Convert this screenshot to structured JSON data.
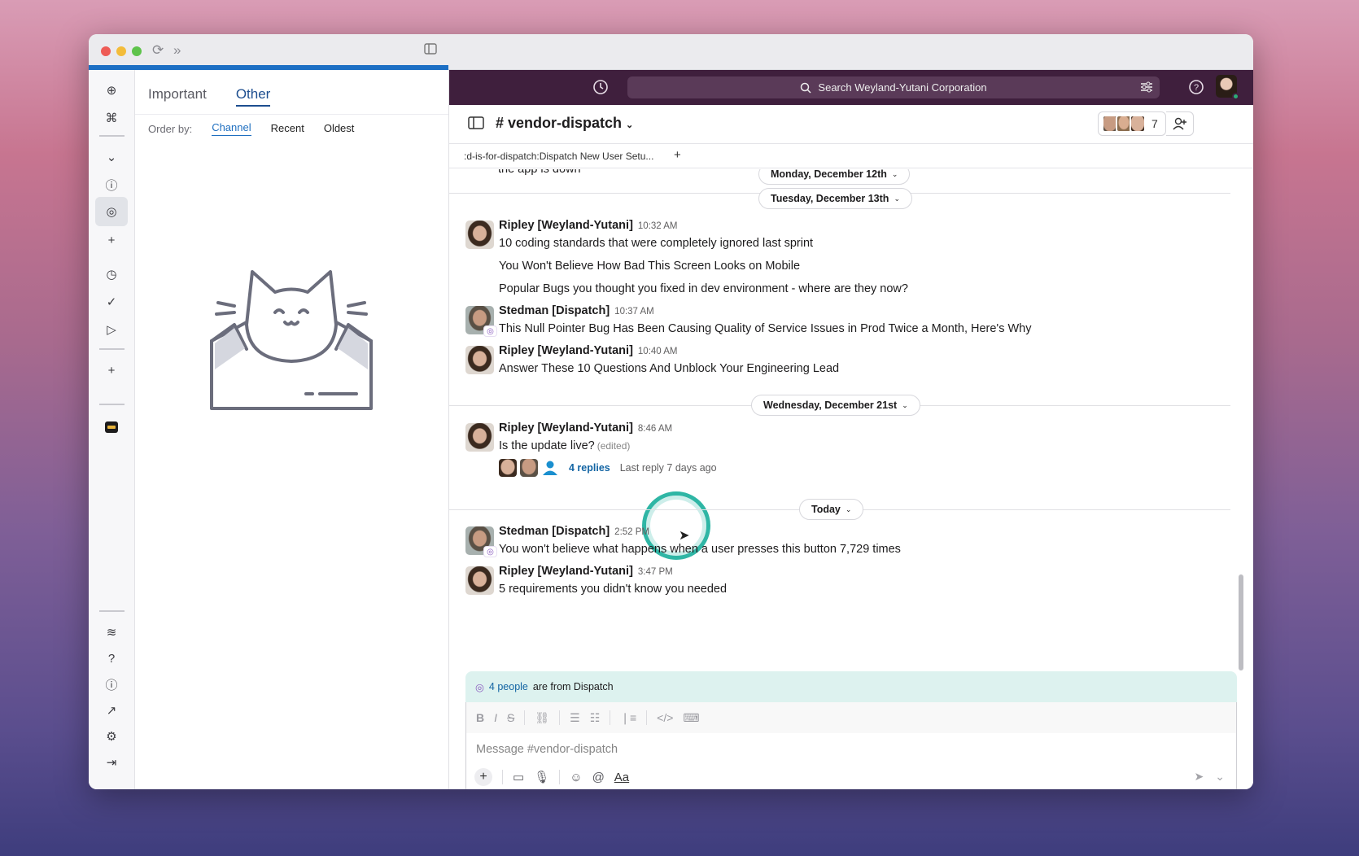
{
  "colors": {
    "accent": "#1d4e8f",
    "topbar": "#3f1f3d",
    "link": "#1264a3",
    "banner": "#ddf2ef"
  },
  "inbox": {
    "tabs": [
      {
        "label": "Important"
      },
      {
        "label": "Other"
      }
    ],
    "order_label": "Order by:",
    "order_options": [
      {
        "label": "Channel"
      },
      {
        "label": "Recent"
      },
      {
        "label": "Oldest"
      }
    ]
  },
  "topbar": {
    "search_placeholder": "Search Weyland-Yutani Corporation"
  },
  "channel": {
    "name": "# vendor-dispatch",
    "member_count": "7",
    "bookmark": ":d-is-for-dispatch:Dispatch New User Setu...",
    "bookmark_add": "+"
  },
  "days": {
    "d1": "Monday, December 12th",
    "d2": "Tuesday, December 13th",
    "d3": "Wednesday, December 21st",
    "d4": "Today"
  },
  "partial_message": "the app is down",
  "messages": [
    {
      "name": "Ripley [Weyland-Yutani]",
      "time": "10:32 AM",
      "lines": [
        "10 coding standards that were completely ignored last sprint",
        "You Won't Believe How Bad This Screen Looks on Mobile",
        "Popular Bugs you thought you fixed in dev environment - where are they now?"
      ]
    },
    {
      "name": "Stedman [Dispatch]",
      "time": "10:37 AM",
      "lines": [
        "This Null Pointer Bug Has Been Causing Quality of Service Issues in Prod Twice a Month, Here's Why"
      ]
    },
    {
      "name": "Ripley [Weyland-Yutani]",
      "time": "10:40 AM",
      "lines": [
        "Answer These 10 Questions And Unblock Your Engineering Lead"
      ]
    },
    {
      "name": "Ripley [Weyland-Yutani]",
      "time": "8:46 AM",
      "lines": [
        "Is the update live?"
      ],
      "edited": "(edited)"
    },
    {
      "name": "Stedman [Dispatch]",
      "time": "2:52 PM",
      "lines": [
        "You won't believe what happens when a user presses this button 7,729 times"
      ]
    },
    {
      "name": "Ripley [Weyland-Yutani]",
      "time": "3:47 PM",
      "lines": [
        "5 requirements you didn't know you needed"
      ]
    }
  ],
  "thread": {
    "replies": "4 replies",
    "last_reply": "Last reply 7 days ago"
  },
  "banner": {
    "people": "4 people",
    "rest": "are from Dispatch"
  },
  "composer": {
    "placeholder": "Message #vendor-dispatch",
    "format_label": "Aa"
  }
}
